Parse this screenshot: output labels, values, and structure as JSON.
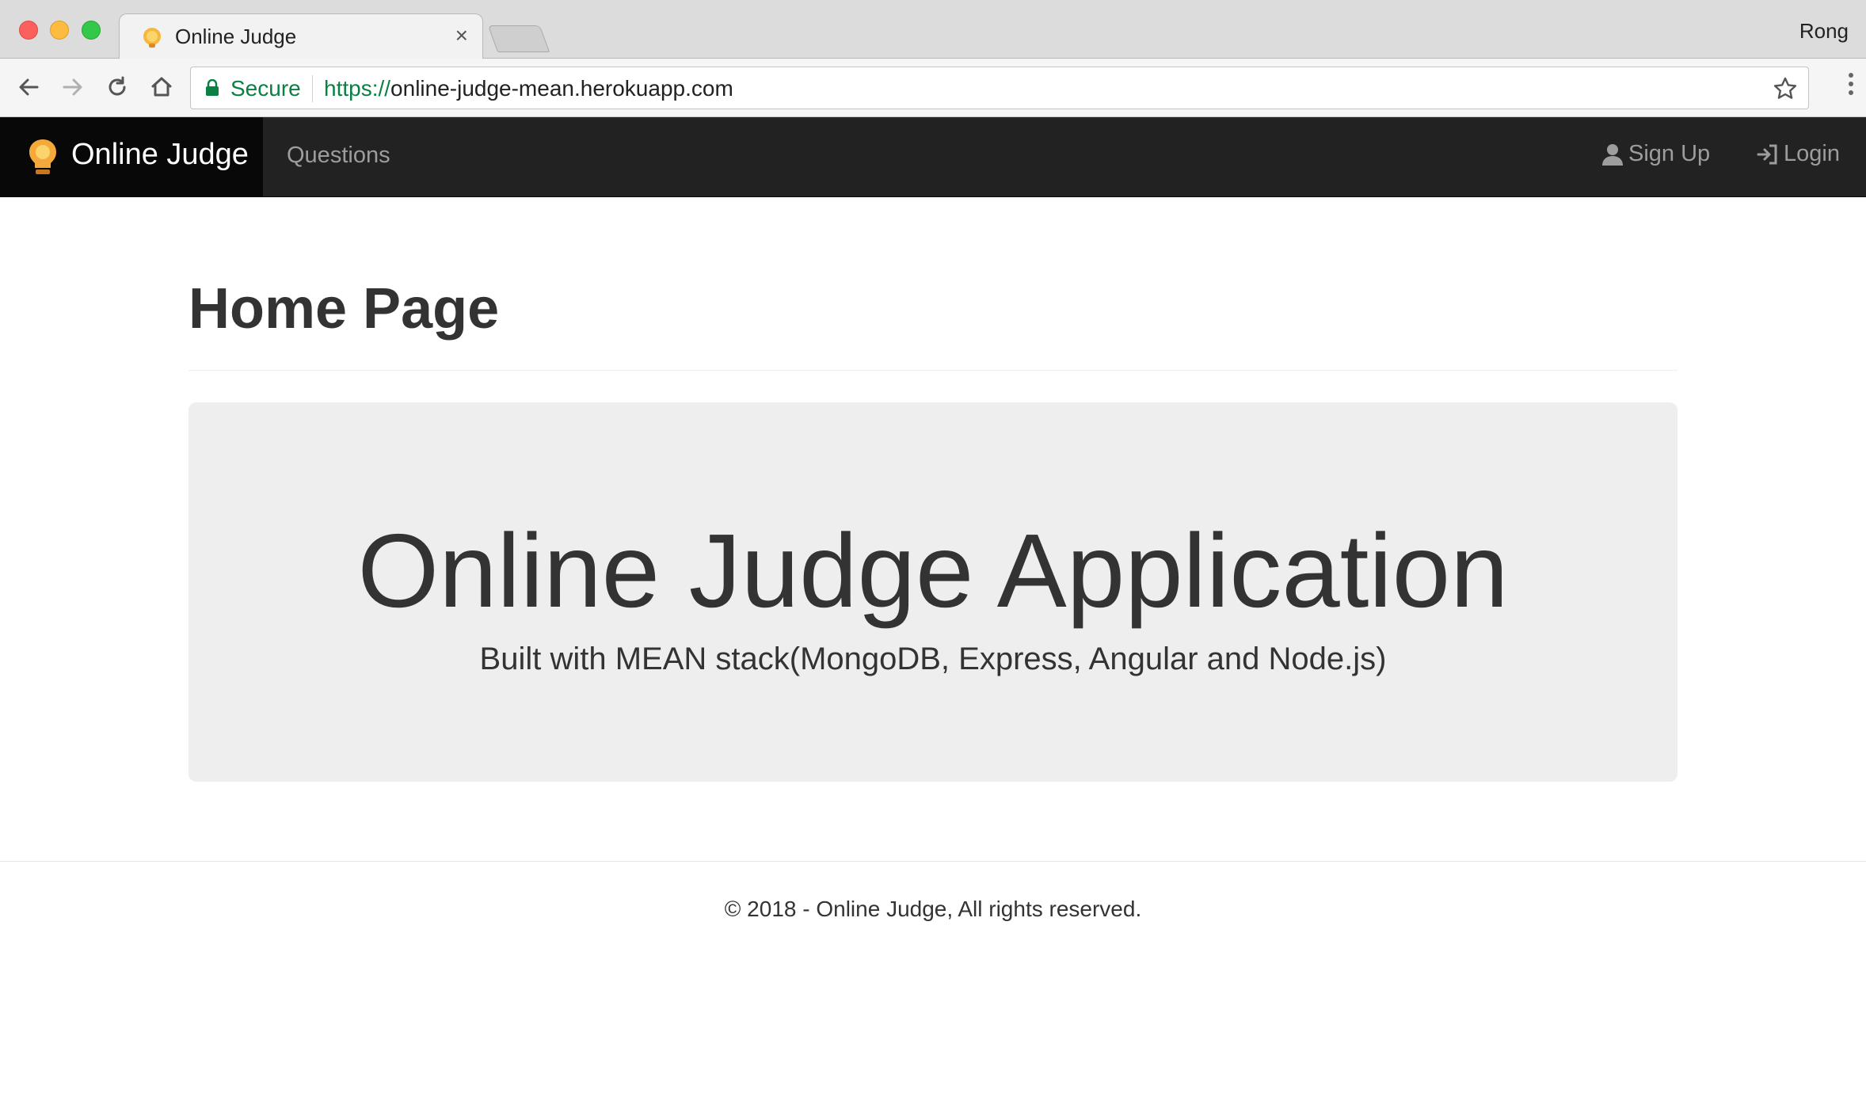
{
  "browser": {
    "tab_title": "Online Judge",
    "tab_close": "×",
    "profile_name": "Rong",
    "secure_label": "Secure",
    "url_scheme": "https://",
    "url_host": "online-judge-mean.herokuapp.com",
    "icons": [
      "back-icon",
      "forward-icon",
      "reload-icon",
      "home-icon",
      "lock-icon",
      "star-icon",
      "menu-icon"
    ]
  },
  "navbar": {
    "brand": "Online Judge",
    "links": [
      {
        "label": "Questions"
      }
    ],
    "right": {
      "signup_label": "Sign Up",
      "login_label": "Login"
    },
    "colors": {
      "background": "#222222",
      "brand_background": "#080808",
      "link": "#9d9d9d"
    }
  },
  "main": {
    "page_title": "Home Page",
    "jumbotron": {
      "title": "Online Judge Application",
      "subtitle": "Built with MEAN stack(MongoDB, Express, Angular and Node.js)"
    }
  },
  "footer": {
    "text": "© 2018 - Online Judge, All rights reserved."
  }
}
